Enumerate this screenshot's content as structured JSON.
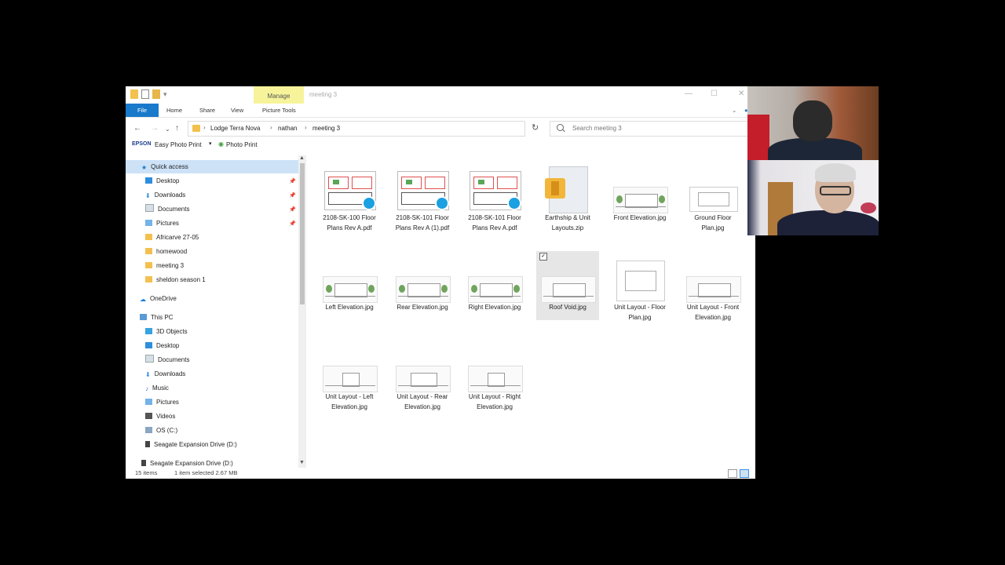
{
  "titlebar": {
    "manage_label": "Manage",
    "window_title": "meeting 3",
    "minimize": "—",
    "maximize": "☐",
    "close": "✕"
  },
  "ribbon": {
    "tabs": [
      "File",
      "Home",
      "Share",
      "View",
      "Picture Tools"
    ]
  },
  "address": {
    "crumbs": [
      "Lodge Terra Nova",
      "nathan",
      "meeting 3"
    ],
    "search_placeholder": "Search meeting 3"
  },
  "toolbar": {
    "epson_label": "EPSON",
    "easy_photo_print": "Easy Photo Print",
    "photo_print": "Photo Print"
  },
  "sidebar": {
    "quick_access": "Quick access",
    "quick_items": [
      "Desktop",
      "Downloads",
      "Documents",
      "Pictures",
      "Africarve 27-05",
      "homewood",
      "meeting 3",
      "sheldon season 1"
    ],
    "onedrive": "OneDrive",
    "this_pc": "This PC",
    "pc_items": [
      "3D Objects",
      "Desktop",
      "Documents",
      "Downloads",
      "Music",
      "Pictures",
      "Videos",
      "OS (C:)",
      "Seagate Expansion Drive (D:)"
    ],
    "bottom_drive": "Seagate Expansion Drive (D:)"
  },
  "files": [
    {
      "name": "2108-SK-100 Floor Plans Rev A.pdf",
      "kind": "pdf"
    },
    {
      "name": "2108-SK-101 Floor Plans Rev A (1).pdf",
      "kind": "pdf"
    },
    {
      "name": "2108-SK-101 Floor Plans Rev A.pdf",
      "kind": "pdf"
    },
    {
      "name": "Earthship & Unit Layouts.zip",
      "kind": "zip"
    },
    {
      "name": "Front Elevation.jpg",
      "kind": "elev"
    },
    {
      "name": "Ground Floor Plan.jpg",
      "kind": "plan"
    },
    {
      "name": "Left Elevation.jpg",
      "kind": "elev"
    },
    {
      "name": "Rear Elevation.jpg",
      "kind": "elev"
    },
    {
      "name": "Right Elevation.jpg",
      "kind": "elev"
    },
    {
      "name": "Roof Void.jpg",
      "kind": "elev",
      "selected": true
    },
    {
      "name": "Unit Layout - Floor Plan.jpg",
      "kind": "plan"
    },
    {
      "name": "Unit Layout - Front Elevation.jpg",
      "kind": "elev"
    },
    {
      "name": "Unit Layout - Left Elevation.jpg",
      "kind": "elev"
    },
    {
      "name": "Unit Layout - Rear Elevation.jpg",
      "kind": "elev"
    },
    {
      "name": "Unit Layout - Right Elevation.jpg",
      "kind": "elev"
    }
  ],
  "status": {
    "count": "15 items",
    "selection": "1 item selected  2.67 MB"
  }
}
